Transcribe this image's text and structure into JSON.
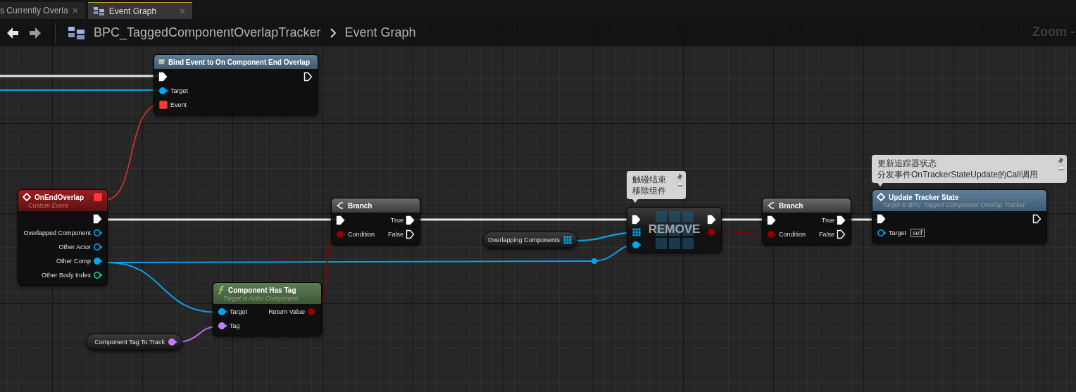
{
  "tabs": [
    {
      "label": "s Currently Overla",
      "selected": false
    },
    {
      "label": "Event Graph",
      "selected": true
    }
  ],
  "toolbar": {
    "blueprint": "BPC_TaggedComponentOverlapTracker",
    "graph": "Event Graph"
  },
  "zoom_label": "Zoom -",
  "comments": [
    {
      "lines": [
        "触碰结束",
        "移除组件"
      ]
    },
    {
      "lines": [
        "更新追踪器状态",
        "分发事件OnTrackerStateUpdate的Call调用"
      ]
    }
  ],
  "nodes": [
    {
      "kind": "call",
      "title": "Bind Event to On Component End Overlap",
      "rows": [
        {
          "in": {
            "kind": "exec",
            "connected": true
          },
          "out": {
            "kind": "exec",
            "connected": false
          }
        },
        {
          "in": {
            "kind": "object",
            "label": "Target",
            "connected": true
          }
        },
        {
          "in": {
            "kind": "delegate",
            "label": "Event",
            "connected": true
          }
        }
      ]
    },
    {
      "kind": "event",
      "title": "OnEndOverlap",
      "subtitle": "Custom Event",
      "header_pin": {
        "kind": "delegate",
        "connected": true
      },
      "rows": [
        {
          "out": {
            "kind": "exec",
            "connected": true
          }
        },
        {
          "out": {
            "kind": "object",
            "label": "Overlapped Component",
            "connected": false
          }
        },
        {
          "out": {
            "kind": "object",
            "label": "Other Actor",
            "connected": false
          }
        },
        {
          "out": {
            "kind": "object",
            "label": "Other Comp",
            "connected": true
          }
        },
        {
          "out": {
            "kind": "int",
            "label": "Other Body Index",
            "connected": false
          }
        }
      ]
    },
    {
      "kind": "branch",
      "title": "Branch",
      "rows": [
        {
          "in": {
            "kind": "exec",
            "connected": true
          },
          "out": {
            "kind": "exec",
            "label": "True",
            "connected": true
          }
        },
        {
          "in": {
            "kind": "bool",
            "label": "Condition",
            "connected": true
          },
          "out": {
            "kind": "exec",
            "label": "False",
            "connected": false
          }
        }
      ]
    },
    {
      "kind": "pure",
      "title": "Component Has Tag",
      "subtitle": "Target is Actor Component",
      "rows": [
        {
          "in": {
            "kind": "object",
            "label": "Target",
            "connected": true
          },
          "out": {
            "kind": "bool",
            "label": "Return Value",
            "connected": true
          }
        },
        {
          "in": {
            "kind": "name",
            "label": "Tag",
            "connected": true
          }
        }
      ]
    },
    {
      "kind": "variable",
      "title": "Component Tag To Track",
      "pin": {
        "kind": "name",
        "connected": true
      }
    },
    {
      "kind": "variable",
      "title": "Overlapping Components",
      "pin": {
        "kind": "array",
        "connected": true
      }
    },
    {
      "kind": "compact",
      "title": "REMOVE",
      "rows": [
        {
          "in": {
            "kind": "exec",
            "connected": true
          },
          "out": {
            "kind": "exec",
            "connected": true
          }
        },
        {
          "in": {
            "kind": "array",
            "connected": true
          },
          "out": {
            "kind": "bool",
            "connected": true
          }
        },
        {
          "in": {
            "kind": "object",
            "connected": true
          }
        }
      ]
    },
    {
      "kind": "branch",
      "title": "Branch",
      "rows": [
        {
          "in": {
            "kind": "exec",
            "connected": true
          },
          "out": {
            "kind": "exec",
            "label": "True",
            "connected": true
          }
        },
        {
          "in": {
            "kind": "bool",
            "label": "Condition",
            "connected": true
          },
          "out": {
            "kind": "exec",
            "label": "False",
            "connected": false
          }
        }
      ]
    },
    {
      "kind": "call",
      "title": "Update Tracker State",
      "subtitle": "Target is BPC Tagged Component Overlap Tracker",
      "rows": [
        {
          "in": {
            "kind": "exec",
            "connected": true
          },
          "out": {
            "kind": "exec",
            "connected": false
          }
        },
        {
          "in": {
            "kind": "object",
            "label": "Target",
            "connected": false,
            "default": "self"
          }
        }
      ]
    }
  ]
}
